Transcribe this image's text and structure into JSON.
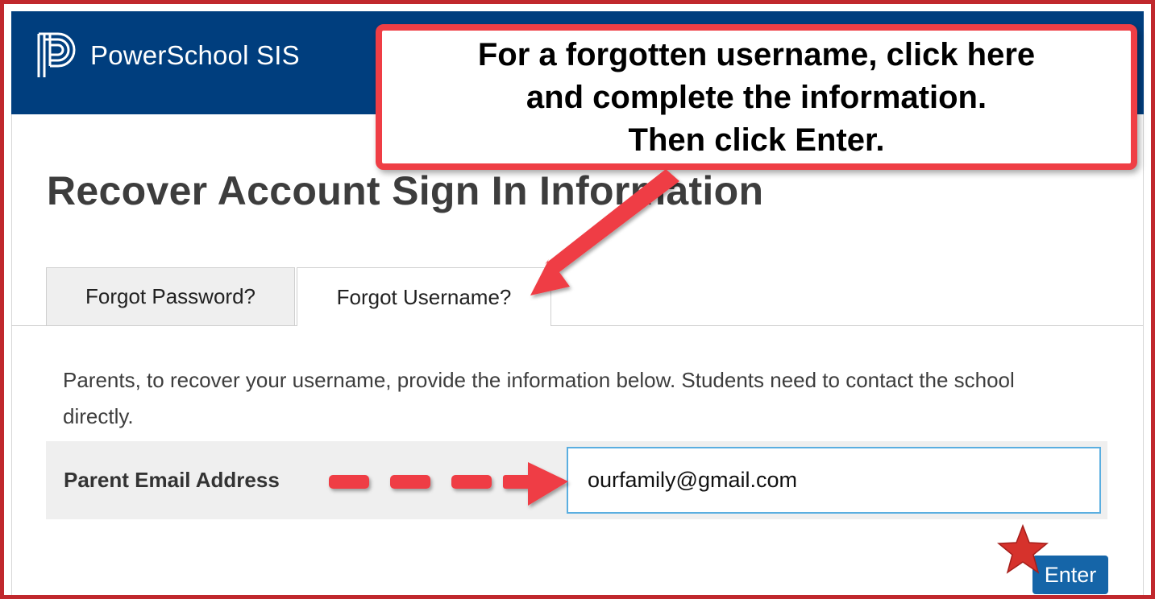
{
  "app": {
    "brand_name": "PowerSchool SIS",
    "logo_icon": "powerschool-p-logo",
    "header_color": "#003e7e"
  },
  "page": {
    "title": "Recover Account Sign In Information"
  },
  "tabs": [
    {
      "label": "Forgot Password?",
      "selected": false
    },
    {
      "label": "Forgot Username?",
      "selected": true
    }
  ],
  "form": {
    "description": "Parents, to recover your username, provide the information below. Students need to contact the school directly.",
    "email_label": "Parent Email Address",
    "email_value": "ourfamily@gmail.com",
    "submit_label": "Enter"
  },
  "annotation": {
    "lines": [
      "For a forgotten username, click here",
      "and complete the information.",
      "Then click Enter."
    ],
    "color": "#ef3e45",
    "markers": [
      "arrow-to-tab",
      "dashed-arrow-to-email-field",
      "star-on-enter-button"
    ]
  }
}
